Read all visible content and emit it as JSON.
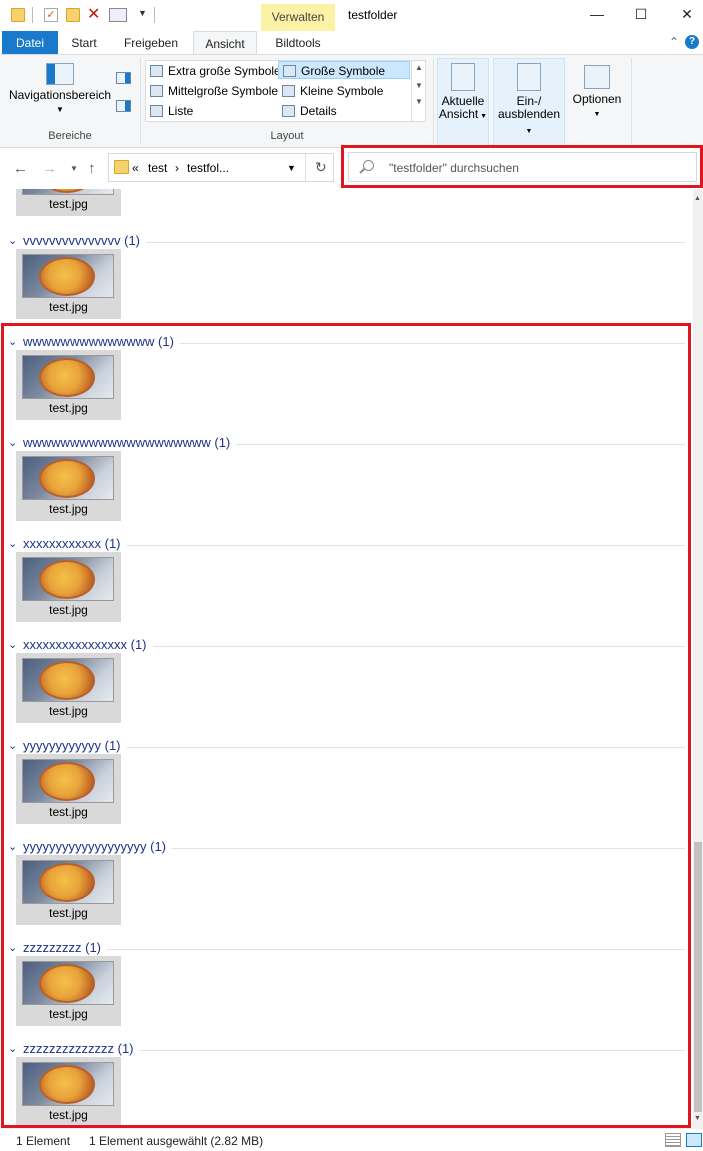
{
  "titlebar": {
    "context_tab": "Verwalten",
    "window_title": "testfolder",
    "minimize": "—",
    "maximize": "☐",
    "close": "✕"
  },
  "tabs": [
    "Datei",
    "Start",
    "Freigeben",
    "Ansicht",
    "Bildtools"
  ],
  "ribbon": {
    "bereiche": {
      "navigationsbereich": "Navigationsbereich",
      "label": "Bereiche"
    },
    "layout": {
      "items": [
        "Extra große Symbole",
        "Große Symbole",
        "Mittelgroße Symbole",
        "Kleine Symbole",
        "Liste",
        "Details"
      ],
      "selected": "Große Symbole",
      "label": "Layout"
    },
    "aktuelle_ansicht": "Aktuelle Ansicht",
    "aktuelle_ansicht_line1": "Aktuelle",
    "aktuelle_ansicht_line2": "Ansicht",
    "ein_ausblenden_line1": "Ein-/",
    "ein_ausblenden_line2": "ausblenden",
    "optionen": "Optionen"
  },
  "address": {
    "breadcrumb_prefix": "«",
    "crumb1": "test",
    "crumb2": "testfol...",
    "separator": "›"
  },
  "search": {
    "placeholder": "\"testfolder\" durchsuchen"
  },
  "groups": [
    {
      "name": "vvvvvvvvvvvvvvv (1)",
      "file": "test.jpg"
    },
    {
      "name": "wwwwwwwwwwwwww (1)",
      "file": "test.jpg"
    },
    {
      "name": "wwwwwwwwwwwwwwwwwwww (1)",
      "file": "test.jpg"
    },
    {
      "name": "xxxxxxxxxxxx (1)",
      "file": "test.jpg"
    },
    {
      "name": "xxxxxxxxxxxxxxxx (1)",
      "file": "test.jpg"
    },
    {
      "name": "yyyyyyyyyyyy (1)",
      "file": "test.jpg"
    },
    {
      "name": "yyyyyyyyyyyyyyyyyyy (1)",
      "file": "test.jpg"
    },
    {
      "name": "zzzzzzzzz (1)",
      "file": "test.jpg"
    },
    {
      "name": "zzzzzzzzzzzzzz (1)",
      "file": "test.jpg"
    }
  ],
  "partial_top_file": "test.jpg",
  "status": {
    "count": "1 Element",
    "selection": "1 Element ausgewählt (2.82 MB)"
  },
  "colors": {
    "accent": "#1979ca",
    "group_header": "#1e3287",
    "highlight_box": "#e0161f",
    "context_tab": "#fbf2a6"
  }
}
